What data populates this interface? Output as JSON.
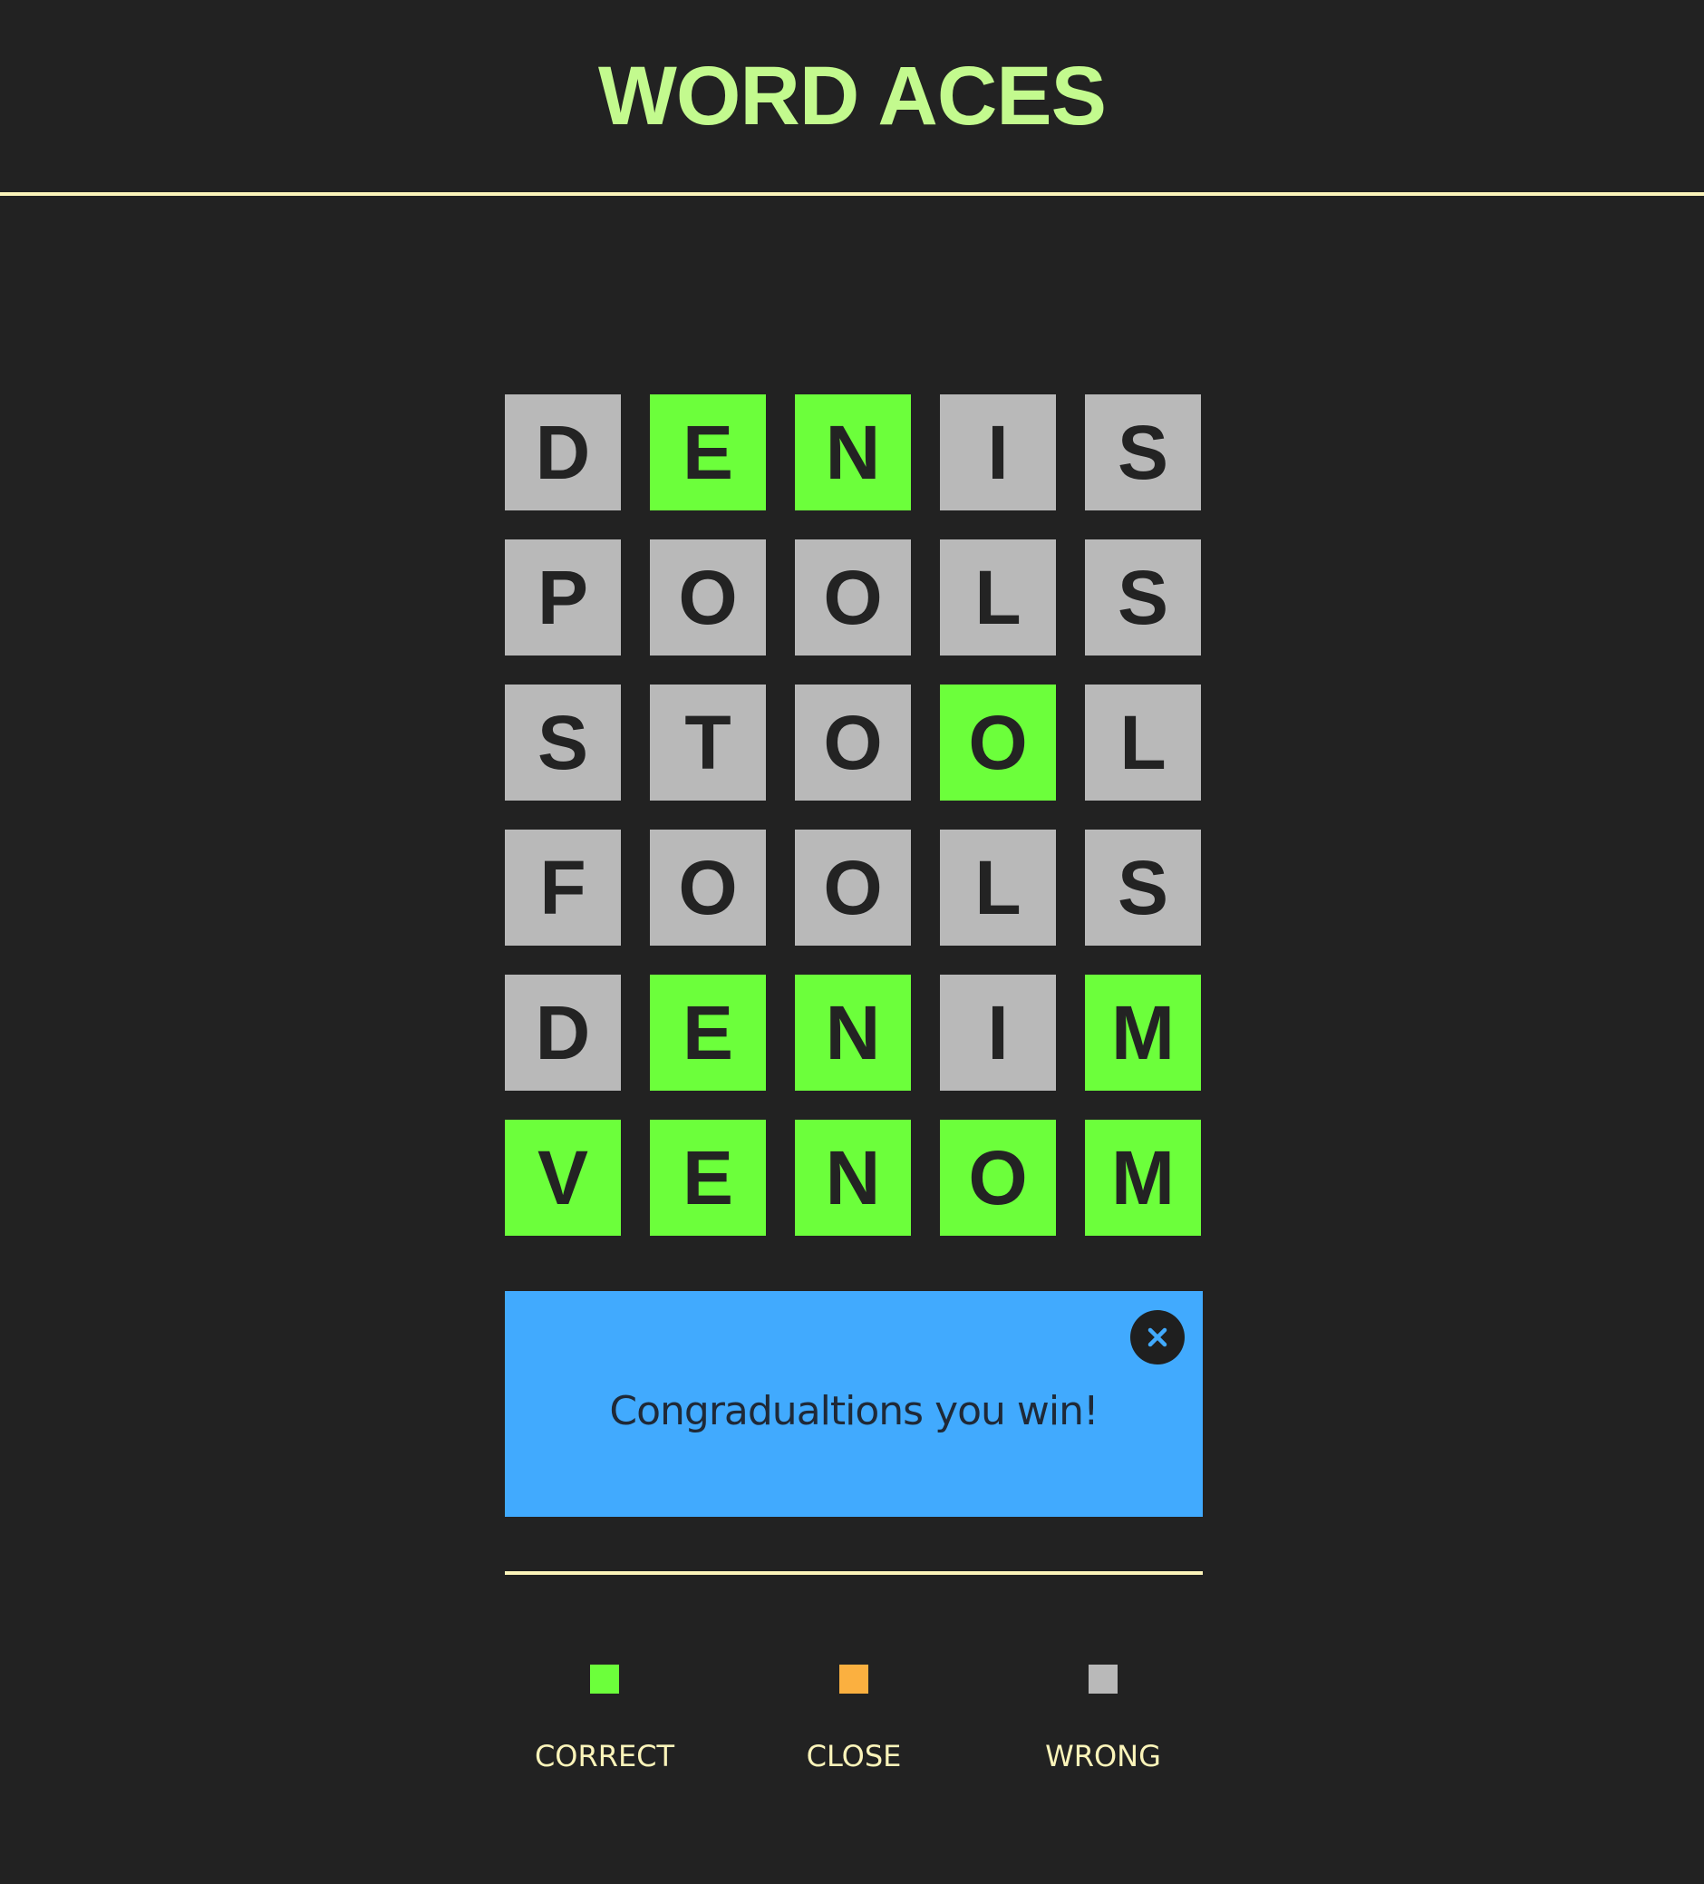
{
  "header": {
    "title": "WORD ACES",
    "title_color": "#c3fa8e"
  },
  "board": {
    "rows": [
      [
        {
          "letter": "D",
          "status": "wrong"
        },
        {
          "letter": "E",
          "status": "correct"
        },
        {
          "letter": "N",
          "status": "correct"
        },
        {
          "letter": "I",
          "status": "wrong"
        },
        {
          "letter": "S",
          "status": "wrong"
        }
      ],
      [
        {
          "letter": "P",
          "status": "wrong"
        },
        {
          "letter": "O",
          "status": "wrong"
        },
        {
          "letter": "O",
          "status": "wrong"
        },
        {
          "letter": "L",
          "status": "wrong"
        },
        {
          "letter": "S",
          "status": "wrong"
        }
      ],
      [
        {
          "letter": "S",
          "status": "wrong"
        },
        {
          "letter": "T",
          "status": "wrong"
        },
        {
          "letter": "O",
          "status": "wrong"
        },
        {
          "letter": "O",
          "status": "correct"
        },
        {
          "letter": "L",
          "status": "wrong"
        }
      ],
      [
        {
          "letter": "F",
          "status": "wrong"
        },
        {
          "letter": "O",
          "status": "wrong"
        },
        {
          "letter": "O",
          "status": "wrong"
        },
        {
          "letter": "L",
          "status": "wrong"
        },
        {
          "letter": "S",
          "status": "wrong"
        }
      ],
      [
        {
          "letter": "D",
          "status": "wrong"
        },
        {
          "letter": "E",
          "status": "correct"
        },
        {
          "letter": "N",
          "status": "correct"
        },
        {
          "letter": "I",
          "status": "wrong"
        },
        {
          "letter": "M",
          "status": "correct"
        }
      ],
      [
        {
          "letter": "V",
          "status": "correct"
        },
        {
          "letter": "E",
          "status": "correct"
        },
        {
          "letter": "N",
          "status": "correct"
        },
        {
          "letter": "O",
          "status": "correct"
        },
        {
          "letter": "M",
          "status": "correct"
        }
      ]
    ]
  },
  "banner": {
    "message": "Congradualtions you win!",
    "close_icon": "close-icon",
    "background": "#41aafe"
  },
  "legend": [
    {
      "label": "CORRECT",
      "color": "#6cff3b"
    },
    {
      "label": "CLOSE",
      "color": "#fbb040"
    },
    {
      "label": "WRONG",
      "color": "#b9b9b9"
    }
  ]
}
